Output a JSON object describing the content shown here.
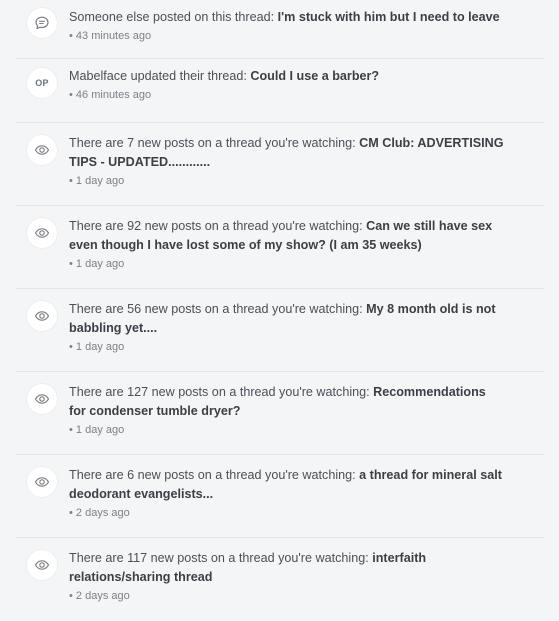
{
  "notifications": [
    {
      "icon": "comment-icon",
      "prefix": "Someone else posted on this thread: ",
      "title": "I'm stuck with him but I need to leave",
      "time": "43 minutes ago"
    },
    {
      "icon": "op-badge",
      "badge_text": "OP",
      "prefix": "Mabelface updated their thread: ",
      "title": "Could I use a barber?",
      "time": "46 minutes ago"
    },
    {
      "icon": "eye-icon",
      "prefix": "There are 7 new posts on a thread you're watching: ",
      "title": "CM Club: ADVERTISING TIPS - UPDATED............",
      "time": "1 day ago"
    },
    {
      "icon": "eye-icon",
      "prefix": "There are 92 new posts on a thread you're watching: ",
      "title": "Can we still have sex even though I have lost some of my show? (I am 35 weeks)",
      "time": "1 day ago"
    },
    {
      "icon": "eye-icon",
      "prefix": "There are 56 new posts on a thread you're watching: ",
      "title": "My 8 month old is not babbling yet....",
      "time": "1 day ago"
    },
    {
      "icon": "eye-icon",
      "prefix": "There are 127 new posts on a thread you're watching: ",
      "title": "Recommendations for condenser tumble dryer?",
      "time": "1 day ago"
    },
    {
      "icon": "eye-icon",
      "prefix": "There are 6 new posts on a thread you're watching: ",
      "title": "a thread for mineral salt deodorant evangelists...",
      "time": "2 days ago"
    },
    {
      "icon": "eye-icon",
      "prefix": "There are 117 new posts on a thread you're watching: ",
      "title": "interfaith relations/sharing thread",
      "time": "2 days ago"
    }
  ],
  "meta_bullet": "•"
}
